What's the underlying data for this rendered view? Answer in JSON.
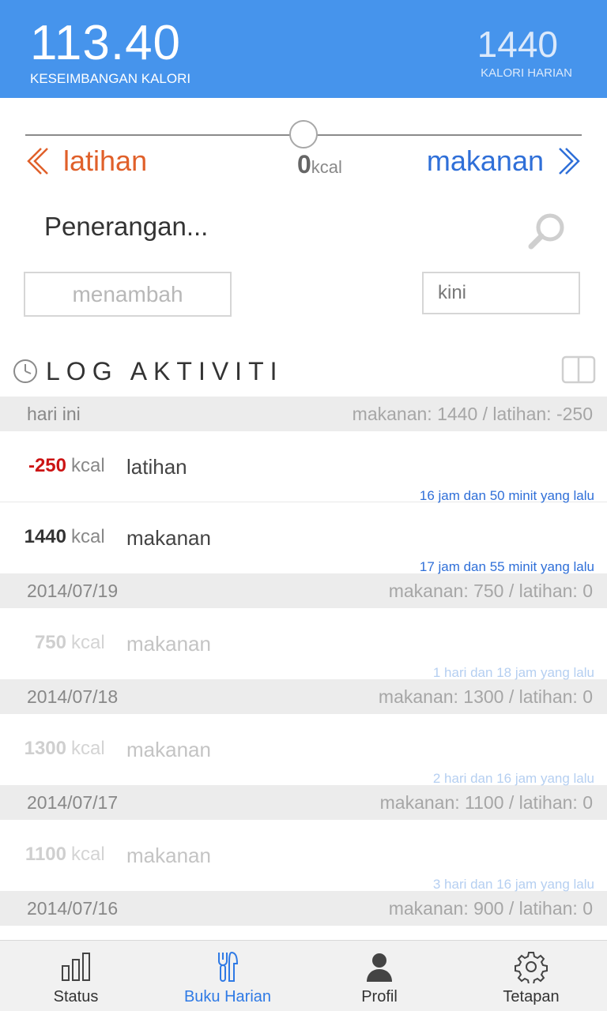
{
  "header": {
    "balance_value": "113.40",
    "balance_label": "KESEIMBANGAN KALORI",
    "daily_value": "1440",
    "daily_label": "KALORI HARIAN",
    "background_color": "#4694ec"
  },
  "slider": {
    "left_label": "latihan",
    "right_label": "makanan",
    "center_value": "0",
    "center_unit": "kcal",
    "left_color": "#e0602a",
    "right_color": "#2f6fd8"
  },
  "entry_form": {
    "description_placeholder": "Penerangan...",
    "add_placeholder": "menambah",
    "time_value": "kini"
  },
  "log": {
    "title": "LOG AKTIVITI",
    "groups": [
      {
        "date": "hari ini",
        "summary": "makanan: 1440 / latihan: -250",
        "entries": [
          {
            "value": "-250",
            "unit": "kcal",
            "kind": "latihan",
            "ago": "16 jam dan 50 minit yang lalu"
          },
          {
            "value": "1440",
            "unit": "kcal",
            "kind": "makanan",
            "ago": "17 jam dan 55 minit yang lalu"
          }
        ]
      },
      {
        "date": "2014/07/19",
        "summary": "makanan: 750 / latihan: 0",
        "entries": [
          {
            "value": "750",
            "unit": "kcal",
            "kind": "makanan",
            "ago": "1 hari dan 18 jam yang lalu"
          }
        ]
      },
      {
        "date": "2014/07/18",
        "summary": "makanan: 1300 / latihan: 0",
        "entries": [
          {
            "value": "1300",
            "unit": "kcal",
            "kind": "makanan",
            "ago": "2 hari dan 16 jam yang lalu"
          }
        ]
      },
      {
        "date": "2014/07/17",
        "summary": "makanan: 1100 / latihan: 0",
        "entries": [
          {
            "value": "1100",
            "unit": "kcal",
            "kind": "makanan",
            "ago": "3 hari dan 16 jam yang lalu"
          }
        ]
      },
      {
        "date": "2014/07/16",
        "summary": "makanan: 900 / latihan: 0",
        "entries": []
      }
    ]
  },
  "nav": {
    "items": [
      {
        "label": "Status",
        "icon": "bar-chart-icon",
        "active": false
      },
      {
        "label": "Buku Harian",
        "icon": "fork-knife-icon",
        "active": true
      },
      {
        "label": "Profil",
        "icon": "person-icon",
        "active": false
      },
      {
        "label": "Tetapan",
        "icon": "gear-icon",
        "active": false
      }
    ],
    "active_color": "#2f7ae5"
  }
}
